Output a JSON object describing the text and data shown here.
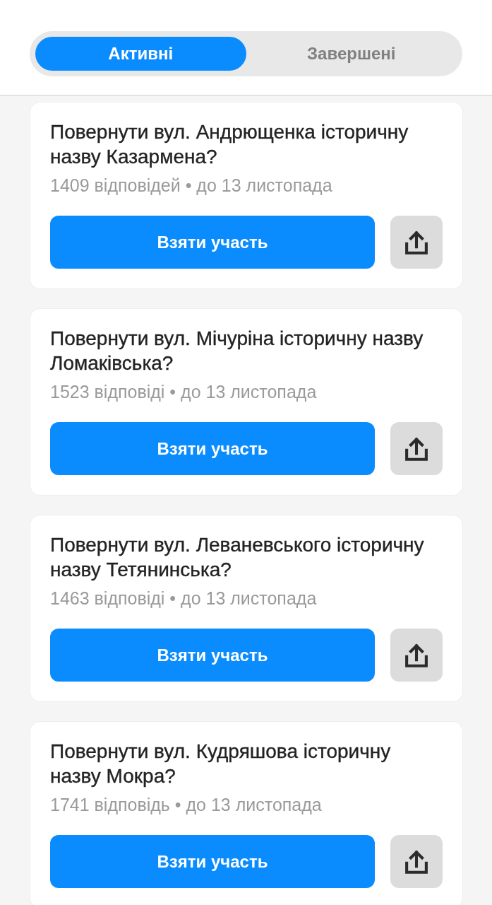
{
  "tabs": [
    {
      "label": "Активні",
      "selected": true
    },
    {
      "label": "Завершені",
      "selected": false
    }
  ],
  "polls": [
    {
      "title": "Повернути вул. Андрющенка історичну назву Казармена?",
      "meta": "1409 відповідей • до 13 листопада",
      "action": "Взяти участь"
    },
    {
      "title": "Повернути вул. Мічуріна історичну назву Ломаківська?",
      "meta": "1523 відповіді • до 13 листопада",
      "action": "Взяти участь"
    },
    {
      "title": "Повернути вул. Леваневського історичну назву Тетянинська?",
      "meta": "1463 відповіді • до 13 листопада",
      "action": "Взяти участь"
    },
    {
      "title": "Повернути вул. Кудряшова історичну назву Мокра?",
      "meta": "1741 відповідь • до 13 листопада",
      "action": "Взяти участь"
    }
  ]
}
